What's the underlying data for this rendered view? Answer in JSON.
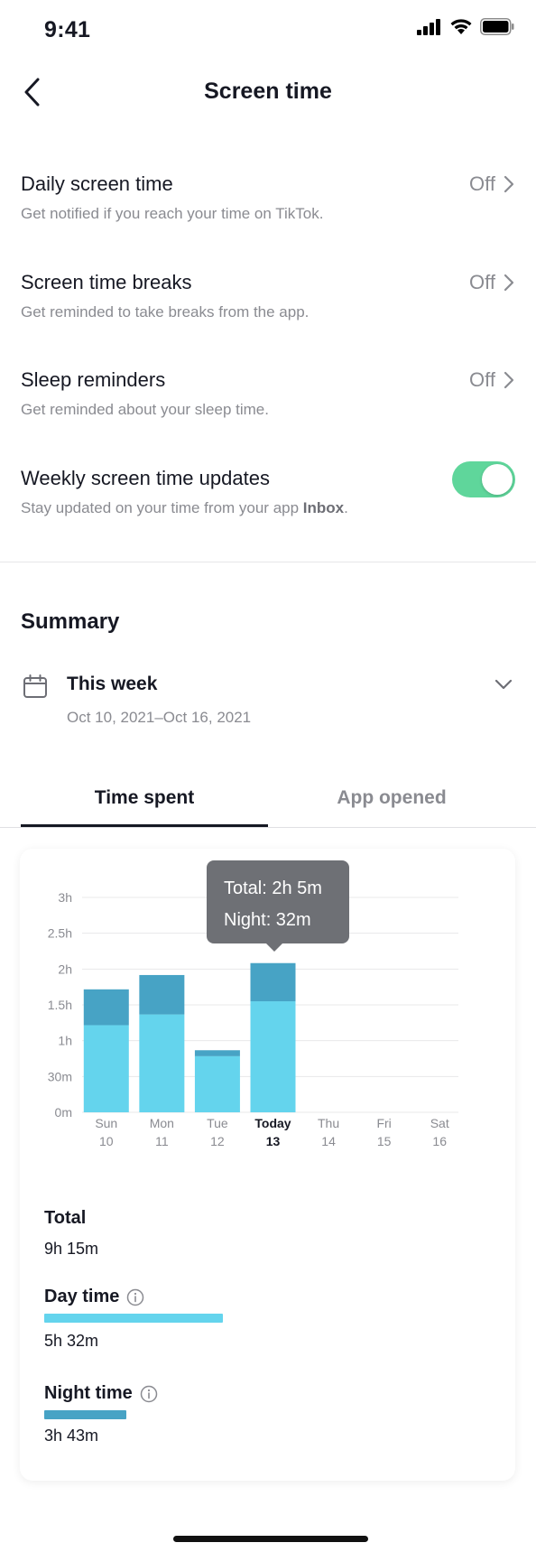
{
  "status_bar": {
    "time": "9:41"
  },
  "nav": {
    "title": "Screen time"
  },
  "settings": [
    {
      "title": "Daily screen time",
      "subtitle": "Get notified if you reach your time on TikTok.",
      "value": "Off"
    },
    {
      "title": "Screen time breaks",
      "subtitle": "Get reminded to take breaks from the app.",
      "value": "Off"
    },
    {
      "title": "Sleep reminders",
      "subtitle": "Get reminded about your sleep time.",
      "value": "Off"
    }
  ],
  "weekly_updates": {
    "title": "Weekly screen time updates",
    "subtitle_prefix": "Stay updated on your time from your app ",
    "subtitle_bold": "Inbox",
    "subtitle_suffix": ".",
    "enabled": true
  },
  "summary": {
    "title": "Summary",
    "period_label": "This week",
    "period_range": "Oct 10, 2021–Oct 16, 2021"
  },
  "tabs": [
    {
      "label": "Time spent",
      "selected": true
    },
    {
      "label": "App opened",
      "selected": false
    }
  ],
  "tooltip": {
    "total": "Total: 2h 5m",
    "night": "Night: 32m"
  },
  "chart_data": {
    "type": "bar",
    "stacked": true,
    "categories": [
      "Sun",
      "Mon",
      "Tue",
      "Today",
      "Thu",
      "Fri",
      "Sat"
    ],
    "dates": [
      "10",
      "11",
      "12",
      "13",
      "14",
      "15",
      "16"
    ],
    "highlight_index": 3,
    "y_tick_labels": [
      "0m",
      "30m",
      "1h",
      "1.5h",
      "2h",
      "2.5h",
      "3h"
    ],
    "y_tick_values_min": [
      0,
      30,
      60,
      90,
      120,
      150,
      180
    ],
    "ylim_min": [
      0,
      180
    ],
    "series": [
      {
        "values_min": [
          73,
          82,
          47,
          93,
          0,
          0,
          0
        ],
        "color": "#64d4ed"
      },
      {
        "values_min": [
          30,
          33,
          5,
          32,
          0,
          0,
          0
        ],
        "color": "#47a3c5"
      }
    ],
    "grid": true
  },
  "stats": {
    "total_label": "Total",
    "total_value": "9h 15m",
    "day_label": "Day time",
    "day_value": "5h 32m",
    "day_color": "#64d4ed",
    "night_label": "Night time",
    "night_value": "3h 43m",
    "night_color": "#47a3c5"
  },
  "icons": {
    "back": "chevron-left-icon",
    "chevron": "chevron-right-icon",
    "calendar": "calendar-icon",
    "dropdown": "chevron-down-icon",
    "info": "info-icon"
  }
}
